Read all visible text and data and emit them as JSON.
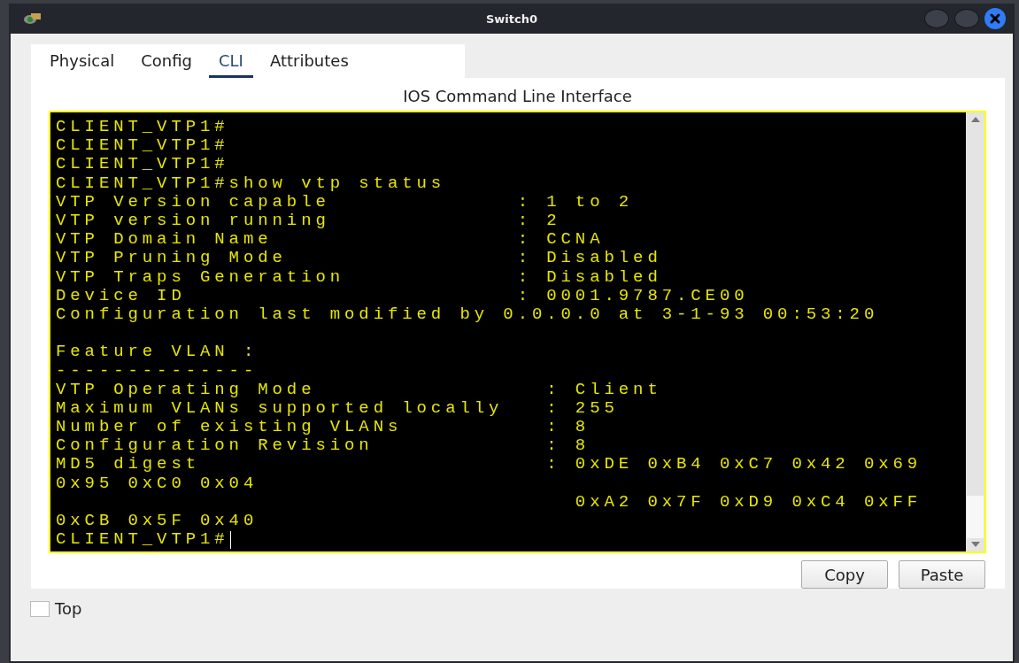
{
  "window": {
    "title": "Switch0"
  },
  "tabs": [
    {
      "label": "Physical",
      "selected": false
    },
    {
      "label": "Config",
      "selected": false
    },
    {
      "label": "CLI",
      "selected": true
    },
    {
      "label": "Attributes",
      "selected": false
    }
  ],
  "panel_title": "IOS Command Line Interface",
  "terminal": {
    "blocks": [
      [
        "CLIENT_VTP1#",
        "CLIENT_VTP1#",
        "CLIENT_VTP1#",
        "CLIENT_VTP1#show vtp status",
        "VTP Version capable             : 1 to 2",
        "VTP version running             : 2",
        "VTP Domain Name                 : CCNA",
        "VTP Pruning Mode                : Disabled",
        "VTP Traps Generation            : Disabled",
        "Device ID                       : 0001.9787.CE00",
        "Configuration last modified by 0.0.0.0 at 3-1-93 00:53:20"
      ],
      [
        "Feature VLAN :",
        "--------------",
        "VTP Operating Mode                : Client",
        "Maximum VLANs supported locally   : 255",
        "Number of existing VLANs          : 8",
        "Configuration Revision            : 8",
        "MD5 digest                        : 0xDE 0xB4 0xC7 0x42 0x69",
        "0x95 0xC0 0x04",
        "                                    0xA2 0x7F 0xD9 0xC4 0xFF",
        "0xCB 0x5F 0x40",
        "CLIENT_VTP1#"
      ]
    ]
  },
  "buttons": [
    "Copy",
    "Paste"
  ],
  "top_checkbox": {
    "label": "Top",
    "checked": false
  }
}
